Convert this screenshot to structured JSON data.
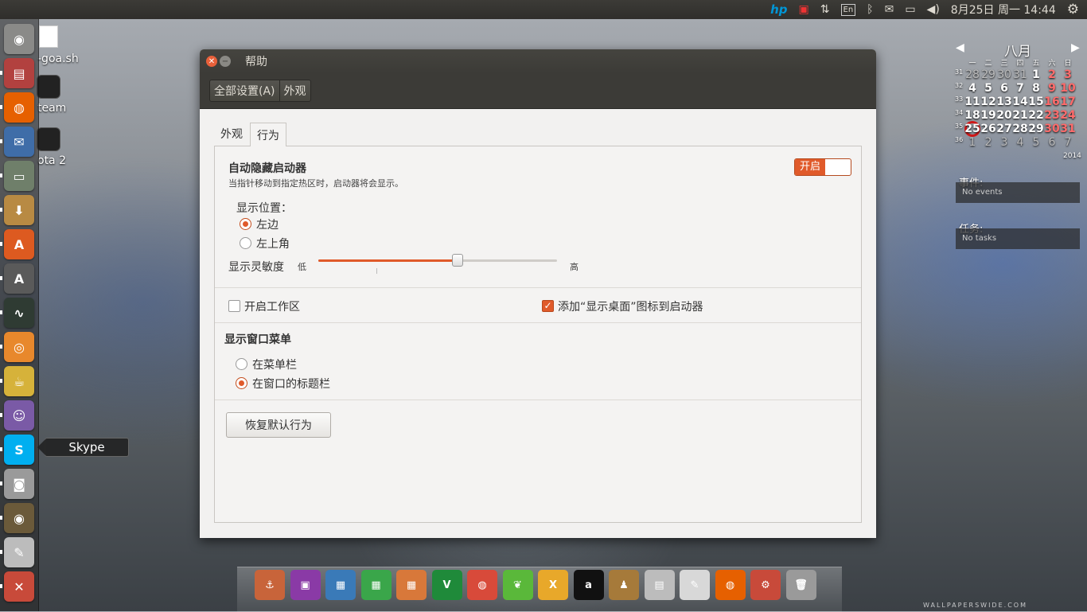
{
  "top_panel": {
    "input_method": "En",
    "clock": "8月25日 周一 14:44"
  },
  "desktop_icons": [
    {
      "label": "-goa.sh"
    },
    {
      "label": "team"
    },
    {
      "label": "ota 2"
    }
  ],
  "launcher": {
    "tooltip": "Skype",
    "items": [
      {
        "name": "dash-home",
        "color": "#8a8a88",
        "glyph": "◉"
      },
      {
        "name": "files",
        "color": "#b2413f",
        "glyph": "▤"
      },
      {
        "name": "firefox",
        "color": "#e66000",
        "glyph": "◍"
      },
      {
        "name": "thunderbird",
        "color": "#3f6da8",
        "glyph": "✉"
      },
      {
        "name": "disk-utility",
        "color": "#6f7f6a",
        "glyph": "▭"
      },
      {
        "name": "archive-manager",
        "color": "#b88a43",
        "glyph": "⬇"
      },
      {
        "name": "software-center",
        "color": "#dd5a20",
        "glyph": "A"
      },
      {
        "name": "update-manager",
        "color": "#5a5a5a",
        "glyph": "A"
      },
      {
        "name": "system-monitor",
        "color": "#2f3b33",
        "glyph": "∿"
      },
      {
        "name": "gimp-shotwell",
        "color": "#e8882c",
        "glyph": "◎"
      },
      {
        "name": "teapot-app",
        "color": "#d6b23a",
        "glyph": "☕"
      },
      {
        "name": "pidgin",
        "color": "#7a5aa6",
        "glyph": "☺"
      },
      {
        "name": "skype",
        "color": "#00aff0",
        "glyph": "S"
      },
      {
        "name": "cheese-camera",
        "color": "#9a9a9a",
        "glyph": "◙"
      },
      {
        "name": "rhythmbox",
        "color": "#6b5a3a",
        "glyph": "◉"
      },
      {
        "name": "text-editor",
        "color": "#bcbcbc",
        "glyph": "✎"
      },
      {
        "name": "system-settings",
        "color": "#c84a3a",
        "glyph": "✕"
      }
    ]
  },
  "window": {
    "title": "帮助",
    "breadcrumb": [
      "全部设置(A)",
      "外观"
    ],
    "tabs": [
      "外观",
      "行为"
    ],
    "active_tab": "行为",
    "autohide": {
      "title": "自动隐藏启动器",
      "description": "当指针移动到指定热区时，启动器将会显示。",
      "toggle_label": "开启",
      "toggle_on": true
    },
    "reveal_location": {
      "label": "显示位置：",
      "options": [
        "左边",
        "左上角"
      ],
      "selected": "左边"
    },
    "sensitivity": {
      "label": "显示灵敏度",
      "low": "低",
      "high": "高",
      "value": 0.58
    },
    "workspaces": {
      "label": "开启工作区",
      "checked": false
    },
    "show_desktop": {
      "label": "添加“显示桌面”图标到启动器",
      "checked": true
    },
    "window_menus": {
      "title": "显示窗口菜单",
      "options": [
        "在菜单栏",
        "在窗口的标题栏"
      ],
      "selected": "在窗口的标题栏"
    },
    "reset_button": "恢复默认行为"
  },
  "calendar": {
    "month": "八月",
    "year": "2014",
    "weekdays": [
      "一",
      "二",
      "三",
      "四",
      "五",
      "六",
      "日"
    ],
    "weeks": [
      {
        "wk": "31",
        "days": [
          "28",
          "29",
          "30",
          "31",
          "1",
          "2",
          "3"
        ]
      },
      {
        "wk": "32",
        "days": [
          "4",
          "5",
          "6",
          "7",
          "8",
          "9",
          "10"
        ]
      },
      {
        "wk": "33",
        "days": [
          "11",
          "12",
          "13",
          "14",
          "15",
          "16",
          "17"
        ]
      },
      {
        "wk": "34",
        "days": [
          "18",
          "19",
          "20",
          "21",
          "22",
          "23",
          "24"
        ]
      },
      {
        "wk": "35",
        "days": [
          "25",
          "26",
          "27",
          "28",
          "29",
          "30",
          "31"
        ]
      },
      {
        "wk": "36",
        "days": [
          "1",
          "2",
          "3",
          "4",
          "5",
          "6",
          "7"
        ]
      }
    ],
    "today": "25",
    "events_title": "事件:",
    "events_empty": "No events",
    "tasks_title": "任务:",
    "tasks_empty": "No tasks"
  },
  "dock": {
    "items": [
      {
        "name": "anchor",
        "color": "#c8643a",
        "glyph": "⚓"
      },
      {
        "name": "video-editor",
        "color": "#8a3aa6",
        "glyph": "▣"
      },
      {
        "name": "libreoffice-draw",
        "color": "#3a7ab8",
        "glyph": "▦"
      },
      {
        "name": "libreoffice-calc",
        "color": "#3aa64a",
        "glyph": "▦"
      },
      {
        "name": "libreoffice-impress",
        "color": "#d8783a",
        "glyph": "▦"
      },
      {
        "name": "vim",
        "color": "#1f8a3a",
        "glyph": "V"
      },
      {
        "name": "chrome",
        "color": "#d84a3a",
        "glyph": "◍"
      },
      {
        "name": "leaf-app",
        "color": "#5ab83a",
        "glyph": "❦"
      },
      {
        "name": "xchat",
        "color": "#e8a82a",
        "glyph": "X"
      },
      {
        "name": "amazon-a",
        "color": "#111111",
        "glyph": "a"
      },
      {
        "name": "chess-pawn",
        "color": "#a67a3a",
        "glyph": "♟"
      },
      {
        "name": "file-cabinet",
        "color": "#bcbcbc",
        "glyph": "▤"
      },
      {
        "name": "text-editor",
        "color": "#d8d8d8",
        "glyph": "✎"
      },
      {
        "name": "firefox",
        "color": "#e66000",
        "glyph": "◍"
      },
      {
        "name": "system-settings",
        "color": "#c84a3a",
        "glyph": "⚙"
      },
      {
        "name": "trash",
        "color": "#9a9a9a",
        "glyph": "🗑"
      }
    ]
  },
  "watermark": "WALLPAPERSWIDE.COM"
}
